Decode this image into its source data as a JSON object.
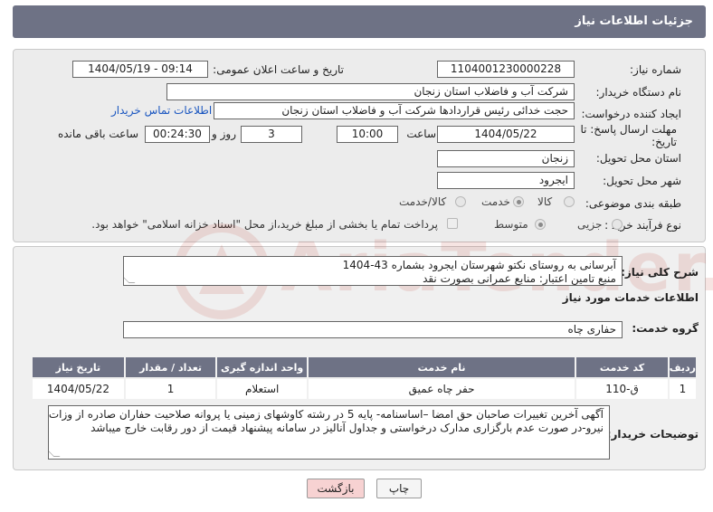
{
  "header": {
    "title": "جزئیات اطلاعات نیاز"
  },
  "form": {
    "need_number_label": "شماره نیاز:",
    "need_number": "1104001230000228",
    "announce_label": "تاریخ و ساعت اعلان عمومی:",
    "announce_value": "1404/05/19 - 09:14",
    "buyer_org_label": "نام دستگاه خریدار:",
    "buyer_org": "شرکت آب و فاضلاب استان زنجان",
    "creator_label": "ایجاد کننده درخواست:",
    "creator": "حجت  خدائی رئیس قراردادها شرکت آب و فاضلاب استان زنجان",
    "contact_link": "اطلاعات تماس خریدار",
    "deadline_label_1": "مهلت ارسال پاسخ: تا",
    "deadline_label_2": "تاریخ:",
    "deadline_date": "1404/05/22",
    "time_label": "ساعت",
    "deadline_time": "10:00",
    "days_value": "3",
    "days_label": "روز و",
    "remaining_value": "00:24:30",
    "remaining_label": "ساعت باقی مانده",
    "province_label": "استان محل تحویل:",
    "province": "زنجان",
    "city_label": "شهر محل تحویل:",
    "city": "ایجرود",
    "category_label": "طبقه بندی موضوعی:",
    "category_options": [
      "کالا",
      "خدمت",
      "کالا/خدمت"
    ],
    "category_selected": "خدمت",
    "process_label": "نوع فرآیند خرید :",
    "process_options": [
      "جزیی",
      "متوسط"
    ],
    "process_selected": "متوسط",
    "treasury_note": "پرداخت تمام یا بخشی از مبلغ خرید،از محل \"اسناد خزانه اسلامی\" خواهد بود."
  },
  "description": {
    "label": "شرح کلی نیاز:",
    "line1": "آبرسانی به روستای نکتو شهرستان ایجرود بشماره 43-1404",
    "line2": "منبع تامین اعتبار: منابع عمرانی بصورت نقد"
  },
  "services": {
    "section_title": "اطلاعات خدمات مورد نیاز",
    "group_label": "گروه خدمت:",
    "group_value": "حفاری چاه",
    "columns": [
      "ردیف",
      "کد خدمت",
      "نام خدمت",
      "واحد اندازه گیری",
      "تعداد / مقدار",
      "تاریخ نیاز"
    ],
    "rows": [
      {
        "index": "1",
        "code": "ق-110",
        "name": "حفر چاه عمیق",
        "unit": "استعلام",
        "qty": "1",
        "date": "1404/05/22"
      }
    ]
  },
  "buyer_notes": {
    "label": "توضیحات خریدار:",
    "line1": "آگهی آخرین تغییرات صاحبان حق امضا –اساسنامه- پایه 5 در رشته کاوشهای زمینی یا پروانه صلاحیت حفاران صادره از وزات",
    "line2": "نیرو-در صورت عدم بارگزاری مدارک درخواستی و جداول آنالیز در سامانه پیشنهاد قیمت از دور رقابت خارج میباشد"
  },
  "buttons": {
    "print": "چاپ",
    "back": "بازگشت"
  },
  "watermark": {
    "text": "AriaTender.neT"
  },
  "colors": {
    "header": "#6e7285",
    "link": "#1a56c0",
    "back_button_bg": "#f7d2d2",
    "watermark": "#c0392b"
  }
}
